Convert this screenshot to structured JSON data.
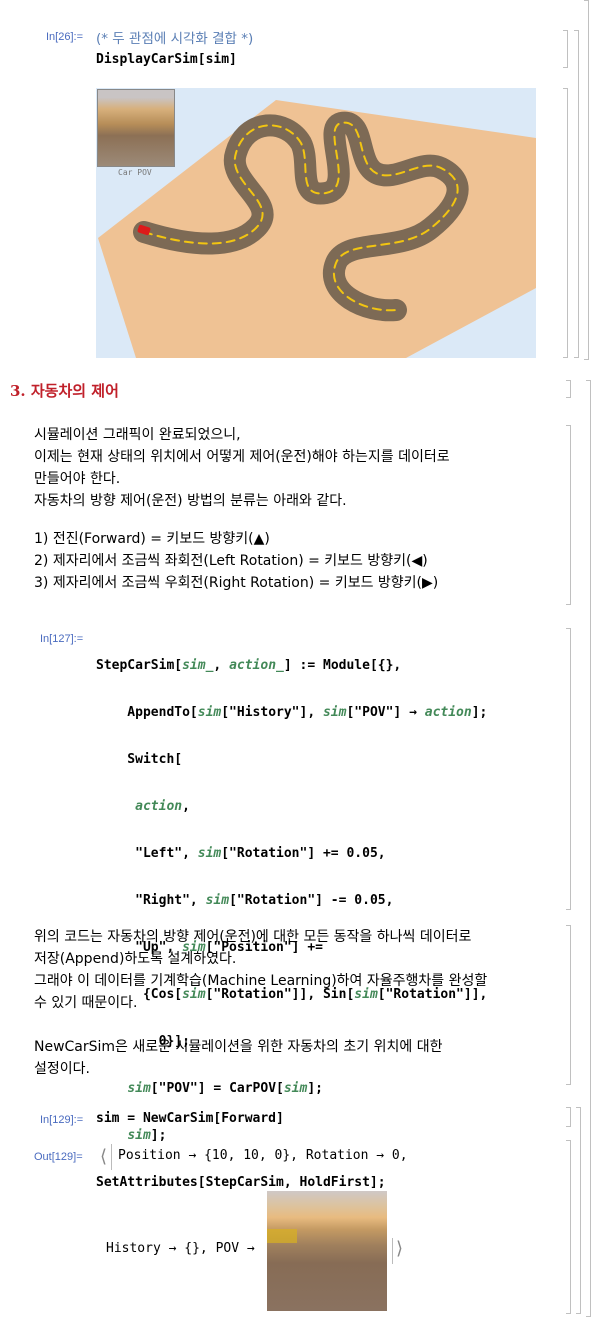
{
  "cells": {
    "in26": {
      "label": "In[26]:=",
      "comment": "(* 두 관점에 시각화 결합 *)",
      "code": "DisplayCarSim[sim]"
    },
    "car_pov_label": "Car POV",
    "section3": {
      "title": "3. 자동차의 제어"
    },
    "para1": [
      "시뮬레이션 그래픽이 완료되었으니,",
      "이제는 현재 상태의 위치에서 어떻게 제어(운전)해야 하는지를 데이터로",
      "만들어야 한다.",
      "자동차의 방향 제어(운전) 방법의 분류는 아래와 같다."
    ],
    "controls": [
      "1) 전진(Forward) = 키보드 방향키(▲)",
      "2) 제자리에서 조금씩 좌회전(Left Rotation) = 키보드 방향키(◀)",
      "3) 제자리에서 조금씩 우회전(Right Rotation) = 키보드 방향키(▶)"
    ],
    "in127": {
      "label": "In[127]:=",
      "lines": [
        "StepCarSim[sim_, action_] := Module[{},",
        "  AppendTo[sim[\"History\"], sim[\"POV\"] → action];",
        "  Switch[",
        "   action,",
        "   \"Left\", sim[\"Rotation\"] += 0.05,",
        "   \"Right\", sim[\"Rotation\"] -= 0.05,",
        "   \"Up\", sim[\"Position\"] +=",
        "    {Cos[sim[\"Rotation\"]], Sin[sim[\"Rotation\"]],",
        "     0}];",
        "  sim[\"POV\"] = CarPOV[sim];",
        "  sim];",
        "SetAttributes[StepCarSim, HoldFirst];"
      ]
    },
    "para2": [
      "위의 코드는 자동차의 방향 제어(운전)에 대한 모든 동작을 하나씩 데이터로",
      "저장(Append)하도록 설계하였다.",
      "그래야 이 데이터를 기계학습(Machine Learning)하여 자율주행차를 완성할",
      "수 있기 때문이다."
    ],
    "para3": [
      "NewCarSim은 새로운 시뮬레이션을 위한 자동차의 초기 위치에 대한",
      "설정이다."
    ],
    "in129": {
      "label": "In[129]:=",
      "code": "sim = NewCarSim[Forward]"
    },
    "out129": {
      "label": "Out[129]=",
      "line1": "Position → {10, 10, 0}, Rotation → 0,",
      "line2": "History → {}, POV →"
    }
  },
  "colors": {
    "label": "#4a6bbf",
    "section": "#c0202a",
    "variable": "#438958",
    "sky": "#dbe9f7",
    "sand": "#efc294",
    "road": "#7d6a55",
    "lane": "#f2c511",
    "car": "#dd1a1a"
  }
}
